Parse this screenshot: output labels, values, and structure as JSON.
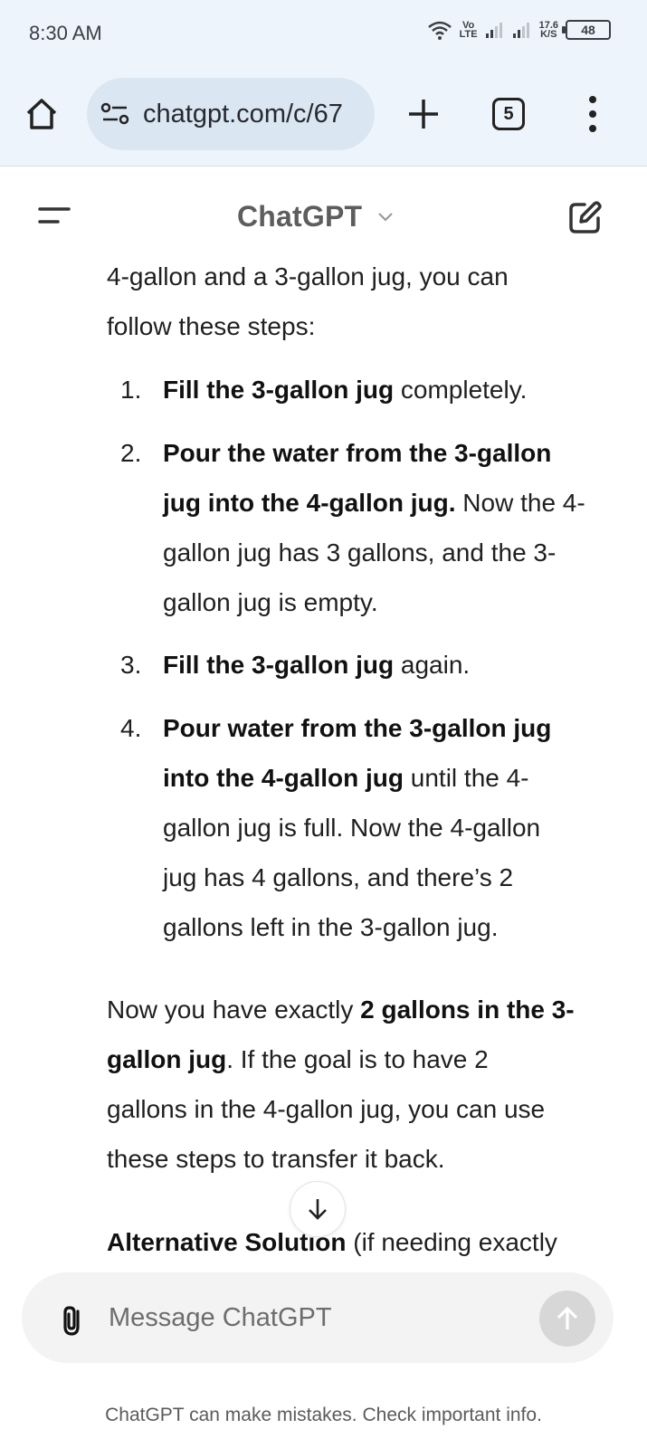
{
  "status_bar": {
    "time": "8:30 AM",
    "volte_top": "Vo",
    "volte_bottom": "LTE",
    "speed_value": "17.6",
    "speed_unit": "K/S",
    "battery": "48",
    "icons": [
      "wifi-icon",
      "signal-icon",
      "signal-icon",
      "battery-icon"
    ]
  },
  "browser": {
    "url": "chatgpt.com/c/67",
    "tab_count": "5",
    "icons": [
      "home-icon",
      "site-settings-icon",
      "plus-icon",
      "tabs-icon",
      "more-vert-icon"
    ]
  },
  "header": {
    "title": "ChatGPT",
    "icons": [
      "menu-icon",
      "chevron-down-icon",
      "new-chat-icon"
    ]
  },
  "message": {
    "intro_line1": "4-gallon and a 3-gallon jug, you can",
    "intro_line2": "follow these steps:",
    "steps": [
      {
        "number": "1.",
        "lines": [
          {
            "bold": "Fill the 3-gallon jug",
            "text": " completely."
          }
        ]
      },
      {
        "number": "2.",
        "lines": [
          {
            "bold": "Pour the water from the 3-gallon",
            "text": ""
          },
          {
            "bold": "jug into the 4-gallon jug.",
            "text": " Now the 4-"
          },
          {
            "bold": "",
            "text": "gallon jug has 3 gallons, and the 3-"
          },
          {
            "bold": "",
            "text": "gallon jug is empty."
          }
        ]
      },
      {
        "number": "3.",
        "lines": [
          {
            "bold": "Fill the 3-gallon jug",
            "text": " again."
          }
        ]
      },
      {
        "number": "4.",
        "lines": [
          {
            "bold": "Pour water from the 3-gallon jug",
            "text": ""
          },
          {
            "bold": "into the 4-gallon jug",
            "text": " until the 4-"
          },
          {
            "bold": "",
            "text": "gallon jug is full. Now the 4-gallon"
          },
          {
            "bold": "",
            "text": "jug has 4 gallons, and there’s 2"
          },
          {
            "bold": "",
            "text": "gallons left in the 3-gallon jug."
          }
        ]
      }
    ],
    "conclusion": [
      {
        "pre": "Now you have exactly ",
        "bold": "2 gallons in the 3-",
        "post": ""
      },
      {
        "pre": "",
        "bold": "gallon jug",
        "post": ". If the goal is to have 2"
      },
      {
        "pre": "gallons in the 4-gallon jug, you can use",
        "bold": "",
        "post": ""
      },
      {
        "pre": "these steps to transfer it back.",
        "bold": "",
        "post": ""
      }
    ],
    "alternative": {
      "bold": "Alternative Solution",
      "text": " (if needing exactly"
    }
  },
  "composer": {
    "placeholder": "Message ChatGPT",
    "icons": [
      "attach-icon",
      "send-arrow-icon",
      "arrow-down-icon"
    ]
  },
  "footer": {
    "disclaimer": "ChatGPT can make mistakes. Check important info."
  }
}
